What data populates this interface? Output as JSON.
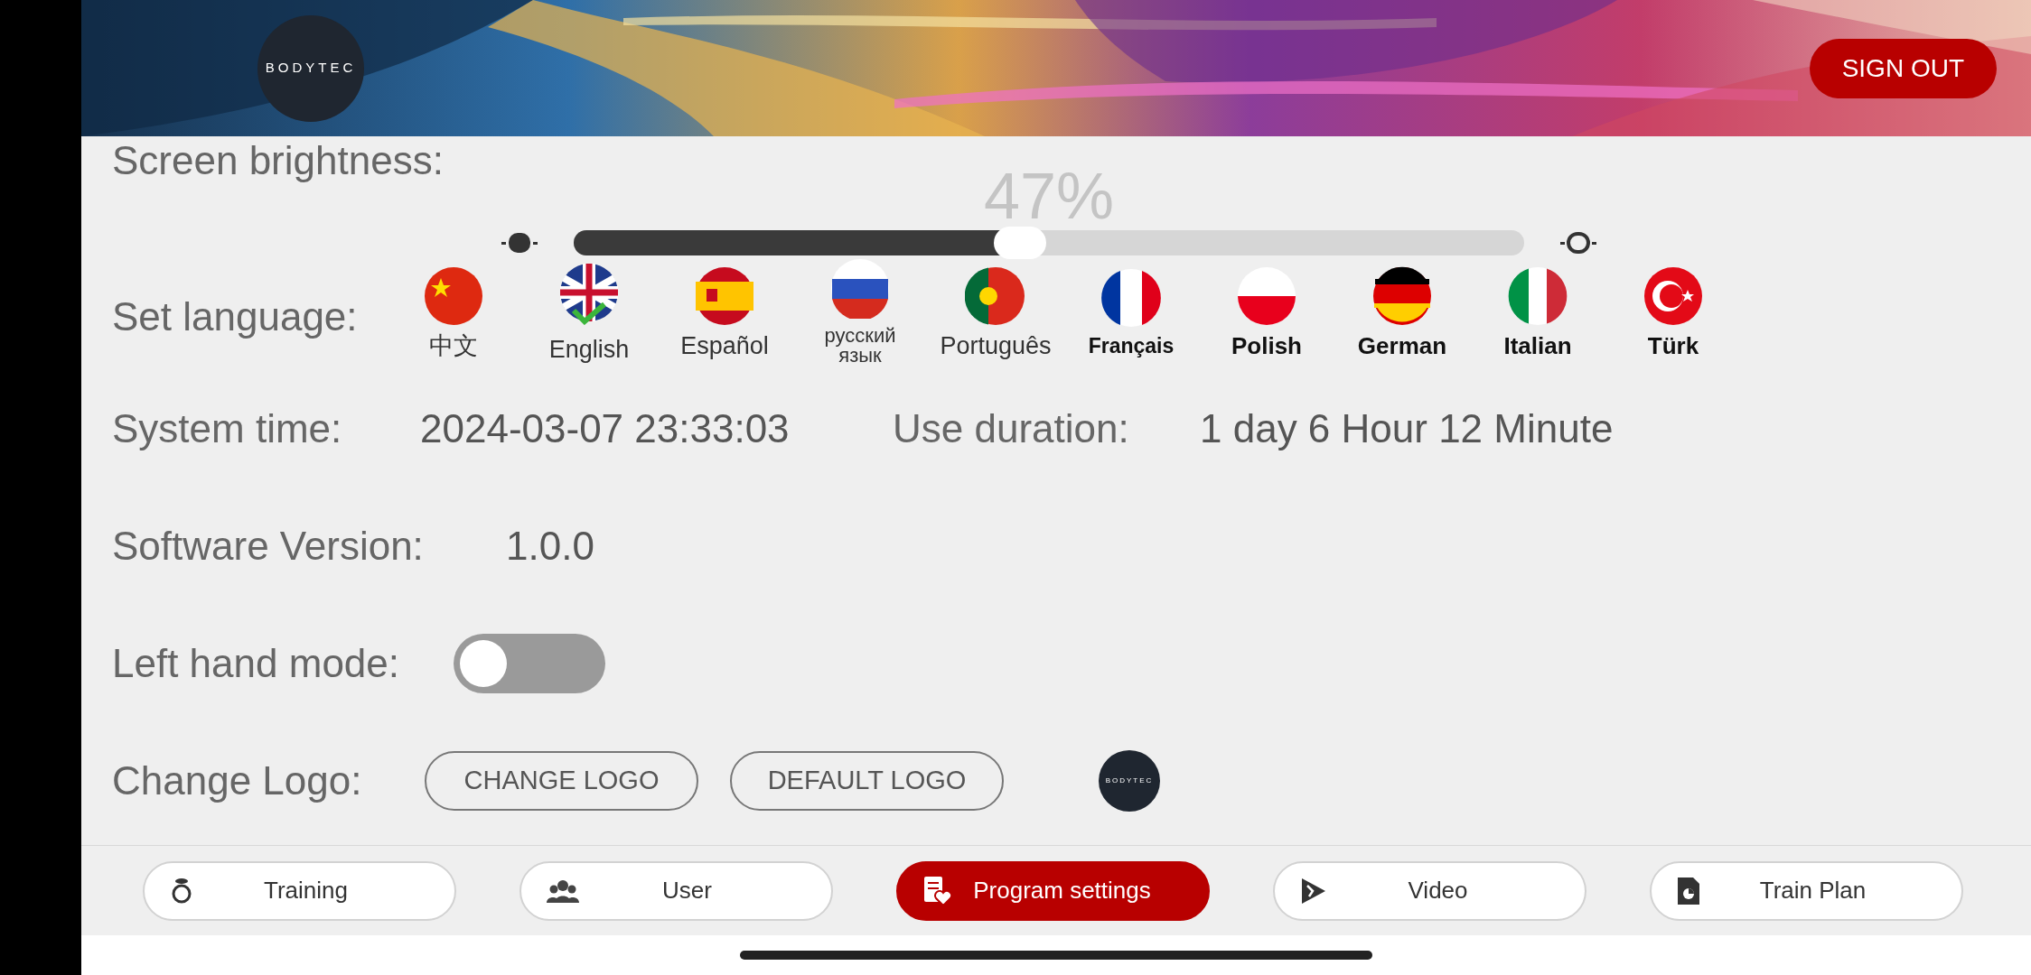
{
  "header": {
    "logo": "BODYTEC",
    "sign_out": "SIGN OUT"
  },
  "brightness": {
    "label": "Screen brightness:",
    "reading": "47%",
    "level": 0.47
  },
  "language": {
    "label": "Set language:",
    "options": [
      {
        "label": "中文",
        "selected": false
      },
      {
        "label": "English",
        "selected": true
      },
      {
        "label": "Español",
        "selected": false
      },
      {
        "label": "русский язык",
        "selected": false
      },
      {
        "label": "Português",
        "selected": false
      },
      {
        "label": "Français",
        "selected": false
      },
      {
        "label": "Polish",
        "selected": false
      },
      {
        "label": "German",
        "selected": false
      },
      {
        "label": "Italian",
        "selected": false
      },
      {
        "label": "Türk",
        "selected": false
      }
    ]
  },
  "system_time": {
    "label": "System time:",
    "value": "2024-03-07 23:33:03"
  },
  "use_duration": {
    "label": "Use duration:",
    "value": "1 day 6 Hour 12 Minute"
  },
  "software_version": {
    "label": "Software Version:",
    "value": "1.0.0"
  },
  "left_hand_mode": {
    "label": "Left hand mode:",
    "on": false
  },
  "change_logo": {
    "label": "Change Logo:",
    "buttons": [
      "CHANGE LOGO",
      "DEFAULT LOGO"
    ],
    "logo": "BODYTEC"
  },
  "nav": [
    {
      "label": "Training",
      "selected": false
    },
    {
      "label": "User",
      "selected": false
    },
    {
      "label": "Program settings",
      "selected": true
    },
    {
      "label": "Video",
      "selected": false
    },
    {
      "label": "Train Plan",
      "selected": false
    }
  ]
}
